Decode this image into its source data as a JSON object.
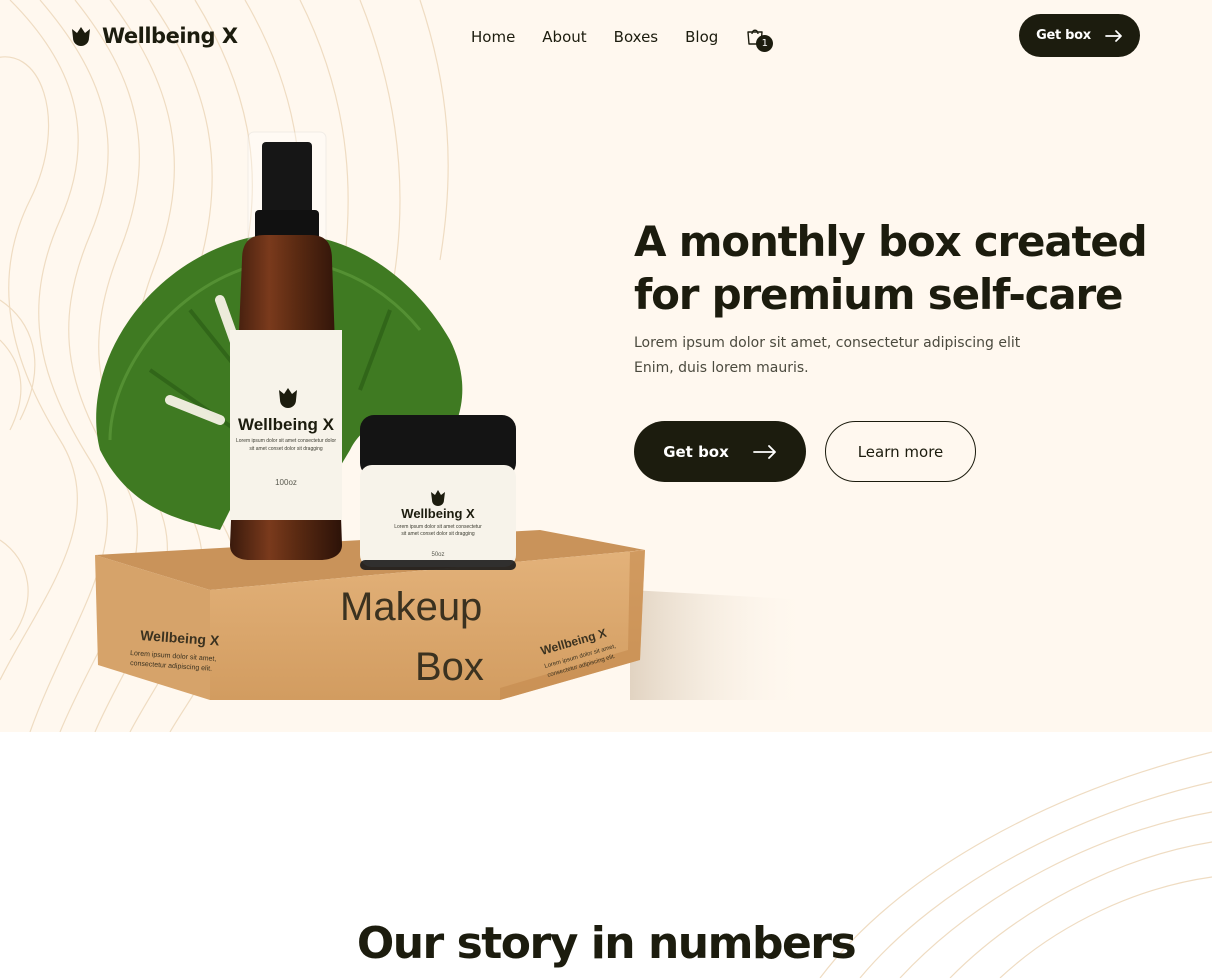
{
  "brand": {
    "name": "Wellbeing X",
    "logo_icon": "tulip-logo-icon"
  },
  "nav": {
    "items": [
      "Home",
      "About",
      "Boxes",
      "Blog"
    ],
    "cart": {
      "icon": "shopping-bag-icon",
      "count": "1"
    }
  },
  "header_cta": {
    "label": "Get box",
    "icon": "arrow-right-icon"
  },
  "hero": {
    "title_line1": "A monthly box created",
    "title_line2": "for premium self-care",
    "subtitle_line1": "Lorem ipsum dolor sit amet, consectetur adipiscing elit",
    "subtitle_line2": "Enim, duis lorem mauris.",
    "primary_cta": "Get box",
    "secondary_cta": "Learn more"
  },
  "product_image": {
    "bottle_brand": "Wellbeing X",
    "bottle_text_1": "Lorem ipsum dolor sit amet consectetur dolor",
    "bottle_text_2": "sit amet conset dolor sit dragging",
    "bottle_size": "100oz",
    "jar_brand": "Wellbeing X",
    "jar_text_1": "Lorem ipsum dolor sit amet consectetur",
    "jar_text_2": "sit amet conset dolor sit dragging",
    "jar_size": "50oz",
    "box_label_1": "Makeup",
    "box_label_2": "Box",
    "box_brand": "Wellbeing X",
    "box_text_1": "Lorem ipsum dolor sit amet,",
    "box_text_2": "consectetur adipiscing elit.",
    "box_side_brand": "Wellbeing X",
    "box_side_text_1": "Lorem ipsum dolor sit amet,",
    "box_side_text_2": "consectetur adipiscing elit."
  },
  "stats_section": {
    "title": "Our story in numbers"
  },
  "colors": {
    "dark": "#1c1c0e",
    "hero_bg": "#fff8ef",
    "contour_lines": "#efdcc2",
    "kraft_box": "#d9a66d",
    "leaf_green": "#3f7a22"
  }
}
